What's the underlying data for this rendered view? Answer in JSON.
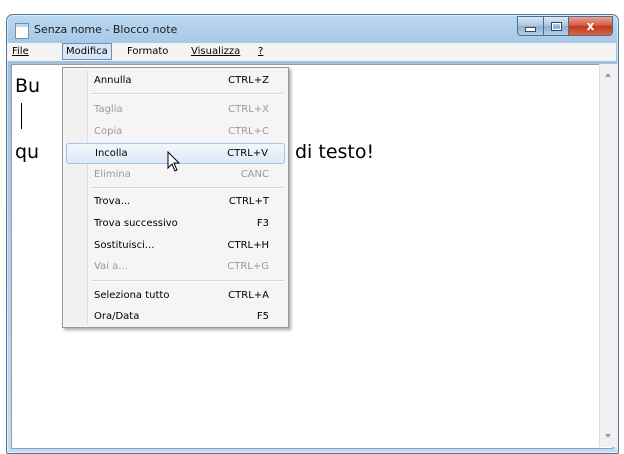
{
  "window": {
    "title": "Senza nome - Blocco note",
    "close_glyph": "x"
  },
  "menubar": {
    "file": "File",
    "modifica": "Modifica",
    "formato": "Formato",
    "visualizza": "Visualizza",
    "help": "?"
  },
  "editor": {
    "line1": "Bu",
    "line3_left": "qu",
    "line3_right": "di testo!"
  },
  "dropdown": {
    "items": [
      {
        "label": "Annulla",
        "shortcut": "CTRL+Z",
        "enabled": true
      },
      {
        "label": "Taglia",
        "shortcut": "CTRL+X",
        "enabled": false
      },
      {
        "label": "Copia",
        "shortcut": "CTRL+C",
        "enabled": false
      },
      {
        "label": "Incolla",
        "shortcut": "CTRL+V",
        "enabled": true,
        "highlighted": true
      },
      {
        "label": "Elimina",
        "shortcut": "CANC",
        "enabled": false
      },
      {
        "label": "Trova...",
        "shortcut": "CTRL+T",
        "enabled": true
      },
      {
        "label": "Trova successivo",
        "shortcut": "F3",
        "enabled": true
      },
      {
        "label": "Sostituisci...",
        "shortcut": "CTRL+H",
        "enabled": true
      },
      {
        "label": "Vai a...",
        "shortcut": "CTRL+G",
        "enabled": false
      },
      {
        "label": "Seleziona tutto",
        "shortcut": "CTRL+A",
        "enabled": true
      },
      {
        "label": "Ora/Data",
        "shortcut": "F5",
        "enabled": true
      }
    ]
  },
  "icons": {
    "app": "notepad-icon",
    "minimize": "minimize-icon",
    "maximize": "maximize-icon",
    "close": "close-icon",
    "cursor": "mouse-pointer-icon"
  },
  "colors": {
    "title_bar": "#a9c9e8",
    "close_button": "#c0361b",
    "menu_highlight": "#dce9f8"
  }
}
